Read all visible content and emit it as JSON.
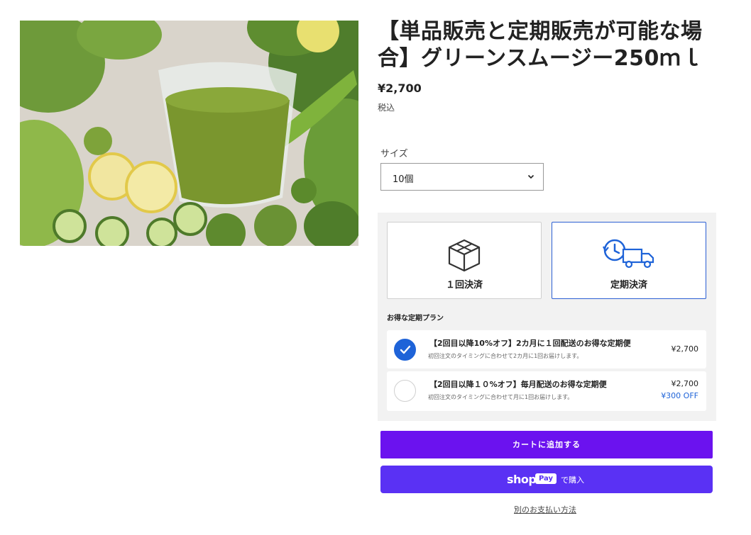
{
  "product": {
    "image_alt": "グリーンスムージーと野菜",
    "title": "【単品販売と定期販売が可能な場合】グリーンスムージー250ｍｌ",
    "price": "¥2,700",
    "tax_note": "税込"
  },
  "variant": {
    "label": "サイズ",
    "selected": "10個"
  },
  "purchase_type": {
    "one_time_label": "１回決済",
    "subscription_label": "定期決済",
    "selected": "subscription"
  },
  "plans": {
    "section_title": "お得な定期プラン",
    "options": [
      {
        "name": "【2回目以降10%オフ】2カ月に１回配送のお得な定期便",
        "description": "初回注文のタイミングに合わせて2カ月に1回お届けします。",
        "price": "¥2,700",
        "discount": "",
        "checked": true
      },
      {
        "name": "【2回目以降１０%オフ】毎月配送のお得な定期便",
        "description": "初回注文のタイミングに合わせて月に1回お届けします。",
        "price": "¥2,700",
        "discount": "¥300 OFF",
        "checked": false
      }
    ]
  },
  "buttons": {
    "add_to_cart": "カートに追加する",
    "shop_logo": "shop",
    "shop_pay_badge": "Pay",
    "shop_pay_suffix": "で購入",
    "other_payment": "別のお支払い方法"
  },
  "colors": {
    "accent_blue": "#1e63d8",
    "cart_purple": "#6b12ef",
    "shop_pay_purple": "#5a31f4"
  }
}
